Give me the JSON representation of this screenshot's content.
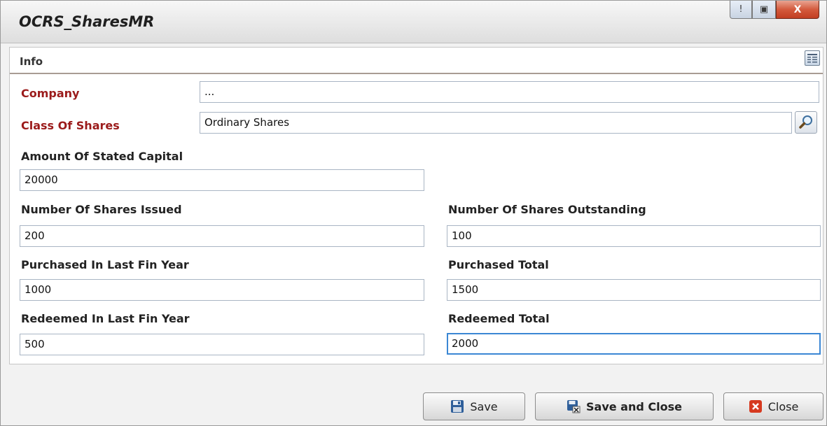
{
  "window": {
    "title": "OCRS_SharesMR",
    "controls": {
      "minimize_glyph": "!",
      "maximize_glyph": "▣",
      "close_glyph": "X"
    }
  },
  "section": {
    "title": "Info",
    "icon": "form-layout-icon"
  },
  "form": {
    "company": {
      "label": "Company",
      "value": "..."
    },
    "class_of_shares": {
      "label": "Class Of Shares",
      "value": "Ordinary Shares",
      "lookup_icon": "magnifier-icon"
    },
    "amount_of_stated_capital": {
      "label": "Amount Of Stated Capital",
      "value": "20000"
    },
    "number_of_shares_issued": {
      "label": "Number Of Shares Issued",
      "value": "200"
    },
    "number_of_shares_outstanding": {
      "label": "Number Of Shares Outstanding",
      "value": "100"
    },
    "purchased_in_last_fin_year": {
      "label": "Purchased In Last Fin Year",
      "value": "1000"
    },
    "purchased_total": {
      "label": "Purchased Total",
      "value": "1500"
    },
    "redeemed_in_last_fin_year": {
      "label": "Redeemed In Last Fin Year",
      "value": "500"
    },
    "redeemed_total": {
      "label": "Redeemed Total",
      "value": "2000"
    }
  },
  "buttons": {
    "save": {
      "label": "Save",
      "icon": "floppy-disk-icon"
    },
    "save_and_close": {
      "label": "Save and Close",
      "icon": "save-close-icon"
    },
    "close": {
      "label": "Close",
      "icon": "red-x-icon"
    }
  },
  "colors": {
    "required_label": "#9b1b1b",
    "focus_border": "#3b87d4",
    "close_button": "#c13e22"
  }
}
